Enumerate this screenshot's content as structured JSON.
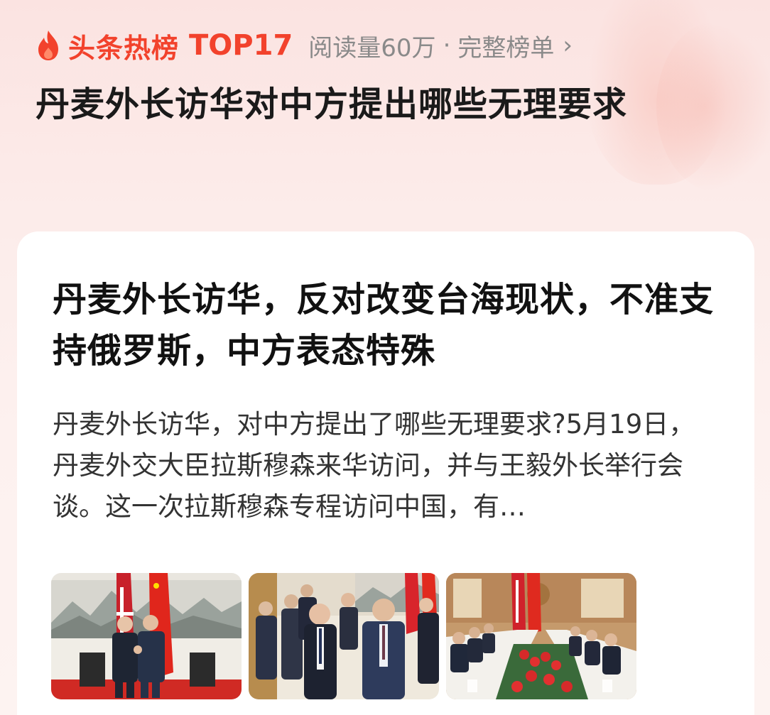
{
  "header": {
    "hot_label": "头条热榜",
    "rank": "TOP17",
    "reads": "阅读量60万",
    "separator": "·",
    "full_list": "完整榜单",
    "chevron": "›",
    "flame_icon": "flame-icon",
    "accent_color": "#f2422c"
  },
  "topic": {
    "title": "丹麦外长访华对中方提出哪些无理要求"
  },
  "article": {
    "title": "丹麦外长访华，反对改变台海现状，不准支持俄罗斯，中方表态特殊",
    "summary": "丹麦外长访华，对中方提出了哪些无理要求?5月19日，丹麦外交大臣拉斯穆森来华访问，并与王毅外长举行会谈。这一次拉斯穆森专程访问中国，有…",
    "images": [
      {
        "description": "handshake-photo"
      },
      {
        "description": "walking-delegation-photo"
      },
      {
        "description": "meeting-table-photo"
      }
    ]
  }
}
